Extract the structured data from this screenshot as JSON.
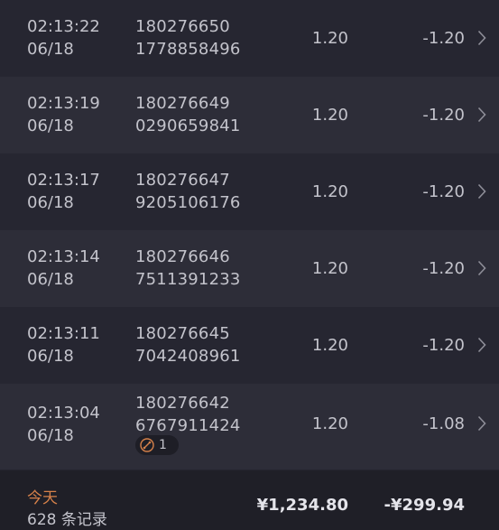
{
  "rows": [
    {
      "time": "02:13:22",
      "date": "06/18",
      "id_line1": "180276650",
      "id_line2": "1778858496",
      "amount": "1.20",
      "net": "-1.20"
    },
    {
      "time": "02:13:19",
      "date": "06/18",
      "id_line1": "180276649",
      "id_line2": "0290659841",
      "amount": "1.20",
      "net": "-1.20"
    },
    {
      "time": "02:13:17",
      "date": "06/18",
      "id_line1": "180276647",
      "id_line2": "9205106176",
      "amount": "1.20",
      "net": "-1.20"
    },
    {
      "time": "02:13:14",
      "date": "06/18",
      "id_line1": "180276646",
      "id_line2": "7511391233",
      "amount": "1.20",
      "net": "-1.20"
    },
    {
      "time": "02:13:11",
      "date": "06/18",
      "id_line1": "180276645",
      "id_line2": "7042408961",
      "amount": "1.20",
      "net": "-1.20"
    },
    {
      "time": "02:13:04",
      "date": "06/18",
      "id_line1": "180276642",
      "id_line2": "6767911424",
      "amount": "1.20",
      "net": "-1.08",
      "badge_count": "1",
      "badge_icon": "chain-link-icon"
    }
  ],
  "footer": {
    "period_label": "今天",
    "record_count": "628 条记录",
    "total_amount": "¥1,234.80",
    "total_net": "-¥299.94"
  },
  "colors": {
    "row_bg": "#262631",
    "row_alt_bg": "#2d2d38",
    "footer_bg": "#1f1f27",
    "text": "#c3c3cb",
    "accent_orange": "#d6814a"
  },
  "icons": {
    "row_action": "chevron-right-icon"
  }
}
